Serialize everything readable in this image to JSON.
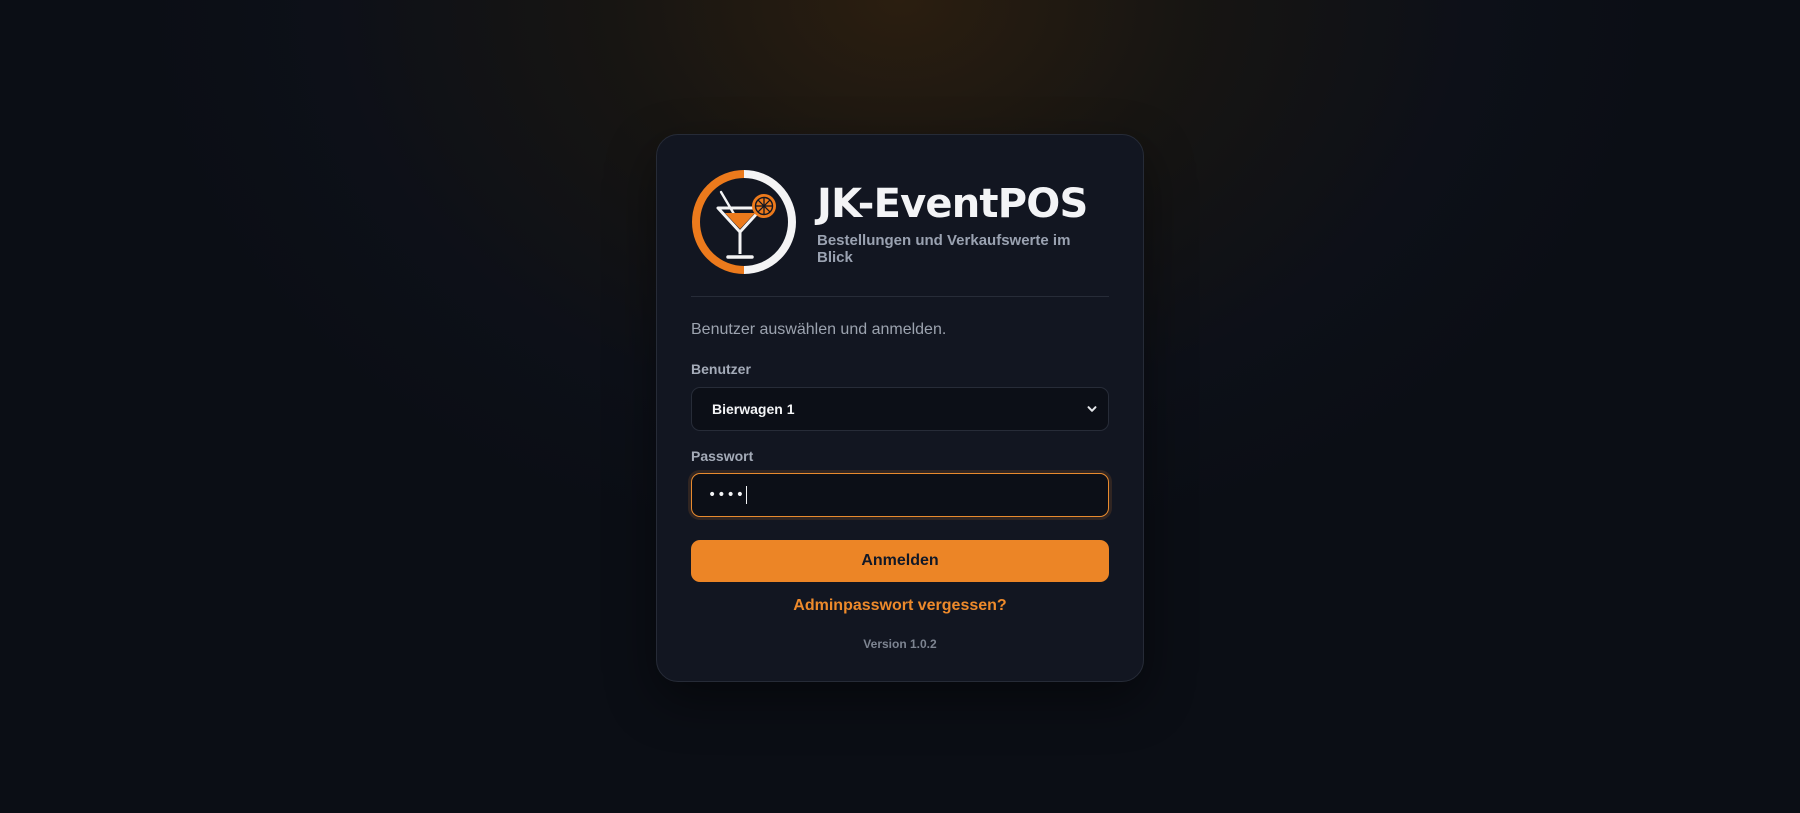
{
  "brand": {
    "logo_icon": "cocktail-glass-icon",
    "title": "JK-EventPOS",
    "subtitle": "Bestellungen und Verkaufswerte im Blick"
  },
  "login": {
    "intro": "Benutzer auswählen und anmelden.",
    "user_label": "Benutzer",
    "user_selected": "Bierwagen 1",
    "password_label": "Passwort",
    "password_masked": "••••",
    "submit_label": "Anmelden",
    "forgot_label": "Adminpasswort vergessen?"
  },
  "footer": {
    "version": "Version 1.0.2"
  },
  "colors": {
    "accent": "#ec8526",
    "card_background": "#121621",
    "page_background": "#0b0e15"
  }
}
